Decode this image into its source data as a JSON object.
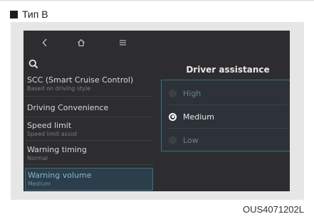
{
  "caption": {
    "label": "Тип B"
  },
  "nav": {
    "back_icon": "chevron-left-icon",
    "home_icon": "home-icon",
    "menu_icon": "hamburger-menu-icon",
    "search_icon": "search-icon"
  },
  "menu": {
    "items": [
      {
        "label": "SCC (Smart Cruise Control)",
        "sub": "Based on driving style"
      },
      {
        "label": "Driving Convenience",
        "sub": ""
      },
      {
        "label": "Speed limit",
        "sub": "Speed limit assist"
      },
      {
        "label": "Warning timing",
        "sub": "Normal"
      },
      {
        "label": "Warning volume",
        "sub": "Medium"
      }
    ]
  },
  "detail": {
    "title": "Driver assistance",
    "options": [
      {
        "label": "High",
        "selected": false
      },
      {
        "label": "Medium",
        "selected": true
      },
      {
        "label": "Low",
        "selected": false
      }
    ]
  },
  "footer": {
    "code": "OUS4071202L"
  },
  "colors": {
    "screen_bg": "#2d2d2f",
    "accent_border": "#3b6f88",
    "selected_bg": "#2b3e4b"
  }
}
